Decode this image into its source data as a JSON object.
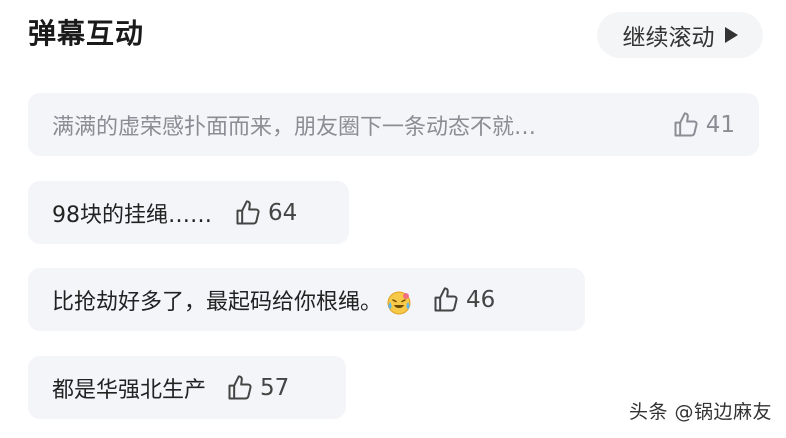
{
  "header": {
    "title": "弹幕互动",
    "scroll_button_label": "继续滚动",
    "scroll_button_icon": "play-icon"
  },
  "comments": [
    {
      "text": "满满的虚荣感扑面而来，朋友圈下一条动态不就…",
      "likes": "41",
      "faded": true
    },
    {
      "text": "98块的挂绳……",
      "likes": "64",
      "faded": false
    },
    {
      "text": "比抢劫好多了，最起码给你根绳。",
      "likes": "46",
      "faded": false,
      "emoji": "crying-laughing-emoji"
    },
    {
      "text": "都是华强北生产",
      "likes": "57",
      "faded": false
    }
  ],
  "like_icon": "thumbs-up-icon",
  "watermark": "头条 @锅边麻友",
  "colors": {
    "item_background": "#f4f5f9",
    "button_background": "#f4f5f7",
    "faded_text": "#8a8d94"
  }
}
